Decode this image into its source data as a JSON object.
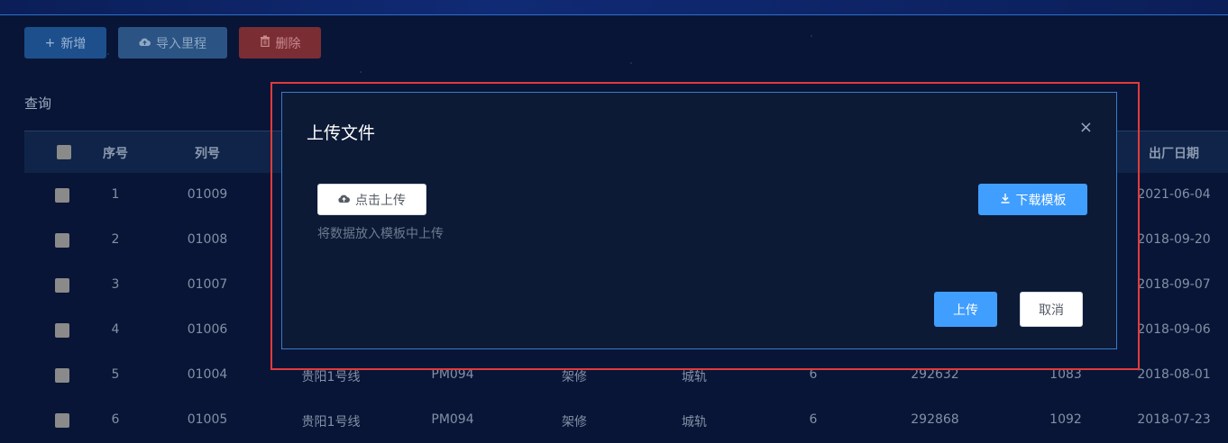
{
  "toolbar": {
    "add_label": "新增",
    "import_label": "导入里程",
    "delete_label": "删除"
  },
  "query_label": "查询",
  "table": {
    "headers": {
      "index": "序号",
      "train_no": "列号",
      "factory_date": "出厂日期"
    },
    "rows": [
      {
        "index": "1",
        "train_no": "01009",
        "line": "",
        "model": "",
        "repair": "",
        "type": "",
        "count": "",
        "mileage": "",
        "value": "",
        "factory_date": "2021-06-04"
      },
      {
        "index": "2",
        "train_no": "01008",
        "line": "",
        "model": "",
        "repair": "",
        "type": "",
        "count": "",
        "mileage": "",
        "value": "",
        "factory_date": "2018-09-20"
      },
      {
        "index": "3",
        "train_no": "01007",
        "line": "",
        "model": "",
        "repair": "",
        "type": "",
        "count": "",
        "mileage": "",
        "value": "",
        "factory_date": "2018-09-07"
      },
      {
        "index": "4",
        "train_no": "01006",
        "line": "",
        "model": "",
        "repair": "",
        "type": "",
        "count": "",
        "mileage": "",
        "value": "",
        "factory_date": "2018-09-06"
      },
      {
        "index": "5",
        "train_no": "01004",
        "line": "贵阳1号线",
        "model": "PM094",
        "repair": "架修",
        "type": "城轨",
        "count": "6",
        "mileage": "292632",
        "value": "1083",
        "factory_date": "2018-08-01"
      },
      {
        "index": "6",
        "train_no": "01005",
        "line": "贵阳1号线",
        "model": "PM094",
        "repair": "架修",
        "type": "城轨",
        "count": "6",
        "mileage": "292868",
        "value": "1092",
        "factory_date": "2018-07-23"
      }
    ]
  },
  "dialog": {
    "title": "上传文件",
    "close_icon": "×",
    "upload_label": "点击上传",
    "upload_tip": "将数据放入模板中上传",
    "download_label": "下载模板",
    "ok_label": "上传",
    "cancel_label": "取消"
  },
  "colors": {
    "primary": "#409eff",
    "highlight_frame": "#e23b3b",
    "dialog_bg": "#0c1a36"
  }
}
